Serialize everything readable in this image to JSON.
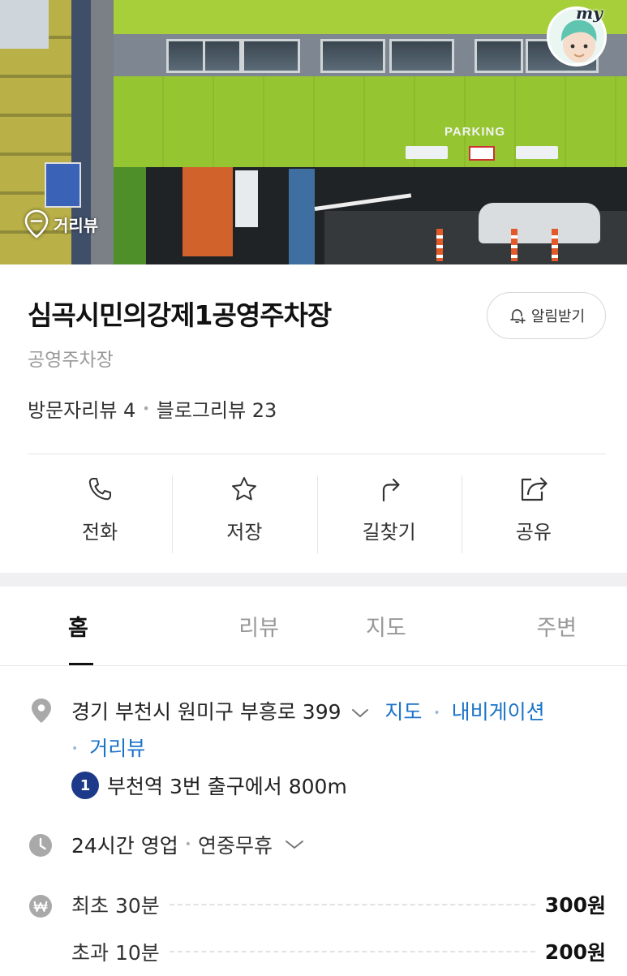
{
  "hero": {
    "parking_sign": "PARKING",
    "roadview_label": "거리뷰",
    "my_label": "my"
  },
  "place": {
    "name": "심곡시민의강제1공영주차장",
    "category": "공영주차장",
    "alarm_button": "알림받기",
    "visitor_reviews": "방문자리뷰 4",
    "separator": "•",
    "blog_reviews": "블로그리뷰 23"
  },
  "actions": [
    {
      "label": "전화",
      "icon": "phone-icon"
    },
    {
      "label": "저장",
      "icon": "star-icon"
    },
    {
      "label": "길찾기",
      "icon": "directions-icon"
    },
    {
      "label": "공유",
      "icon": "share-icon"
    }
  ],
  "tabs": [
    {
      "label": "홈",
      "active": true
    },
    {
      "label": "리뷰",
      "active": false
    },
    {
      "label": "지도",
      "active": false
    },
    {
      "label": "주변",
      "active": false
    }
  ],
  "info": {
    "address": "경기 부천시 원미구 부흥로 399",
    "map_link": "지도",
    "navigation_link": "내비게이션",
    "roadview_link": "거리뷰",
    "link_separator": "•",
    "subway_line": "1",
    "subway_text": "부천역 3번 출구에서 800m",
    "hours": "24시간 영업",
    "hours_separator": "•",
    "holiday": "연중무휴"
  },
  "fees": [
    {
      "label": "최초 30분",
      "price": "300",
      "unit": "원"
    },
    {
      "label": "초과 10분",
      "price": "200",
      "unit": "원"
    }
  ],
  "colors": {
    "link": "#1a73c7",
    "subway_line_1": "#1d3a8a",
    "facade_green": "#96c532"
  }
}
